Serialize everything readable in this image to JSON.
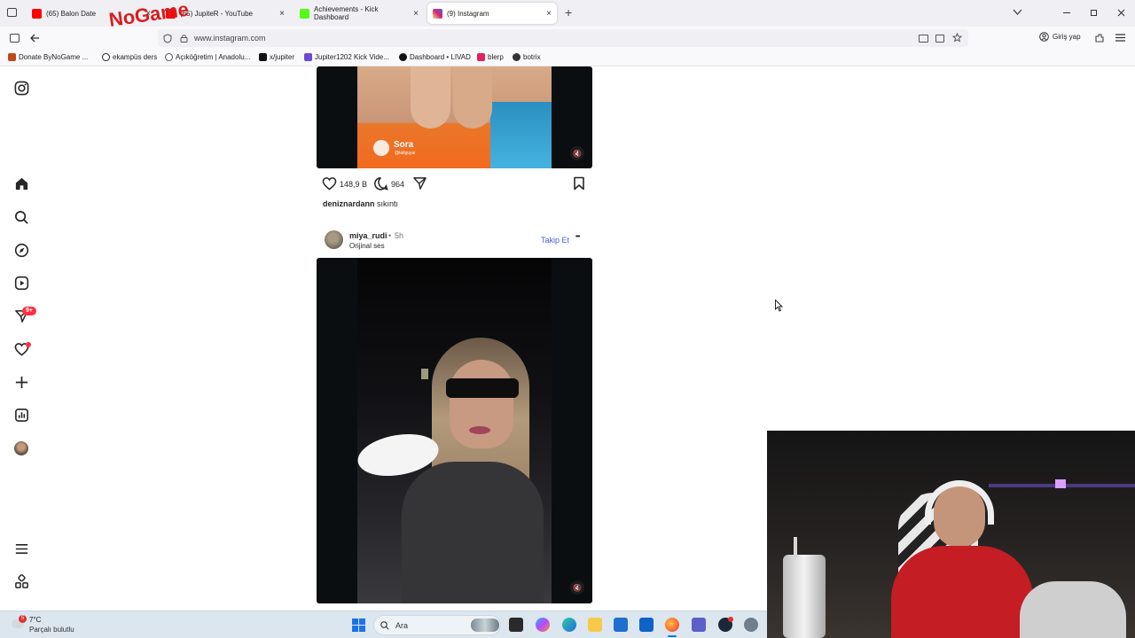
{
  "browser": {
    "tabs": [
      {
        "label": "(65) Balon Date",
        "close": "×",
        "color": "#ff0000"
      },
      {
        "label": "(65) JupiteR - YouTube",
        "close": "×",
        "color": "#ff0000"
      },
      {
        "label": "Achievements - Kick Dashboard",
        "close": "×",
        "color": "#53fc18"
      },
      {
        "label": "(9) Instagram",
        "close": "×",
        "color": "#d62976"
      }
    ],
    "new_tab": "+",
    "url": "www.instagram.com",
    "sign_in": "Giriş yap",
    "bookmarks": [
      {
        "label": "Donate ByNoGame ...",
        "color": "#c04a1a"
      },
      {
        "label": "ekampüs ders",
        "color": "#222222"
      },
      {
        "label": "Açıköğretim | Anadolu...",
        "color": "#555555"
      },
      {
        "label": "x/jupiter",
        "color": "#111111"
      },
      {
        "label": "Jupiter1202 Kick Vide...",
        "color": "#6b4bd6"
      },
      {
        "label": "Dashboard • LIVAD",
        "color": "#111111"
      },
      {
        "label": "blerp",
        "color": "#e0245e"
      },
      {
        "label": "botrix",
        "color": "#333333"
      }
    ],
    "overlay_logo": "ByNoGame"
  },
  "sidebar": {
    "notification_badge": "9+",
    "icons": [
      "instagram-logo-icon",
      "home-icon",
      "search-icon",
      "explore-icon",
      "reels-icon",
      "messages-icon",
      "notifications-icon",
      "create-icon",
      "dashboard-icon",
      "profile-avatar",
      "more-menu-icon",
      "threads-icon"
    ]
  },
  "post1": {
    "watermark_name": "Sora",
    "watermark_handle": "@tallguyai",
    "likes": "148,9 B",
    "comments": "964",
    "caption_user": "deniznardann",
    "caption_text": "sıkıntı"
  },
  "post2": {
    "username": "miya_rudi",
    "separator": "•",
    "time": "5h",
    "audio": "Orijinal ses",
    "follow": "Takip Et",
    "more": "•••"
  },
  "taskbar": {
    "weather_badge": "5",
    "temperature": "7°C",
    "condition": "Parçalı bulutlu",
    "search_placeholder": "Ara"
  },
  "colors": {
    "follow": "#4a5de0",
    "badge": "#ff3040",
    "ig_text": "#262626"
  }
}
